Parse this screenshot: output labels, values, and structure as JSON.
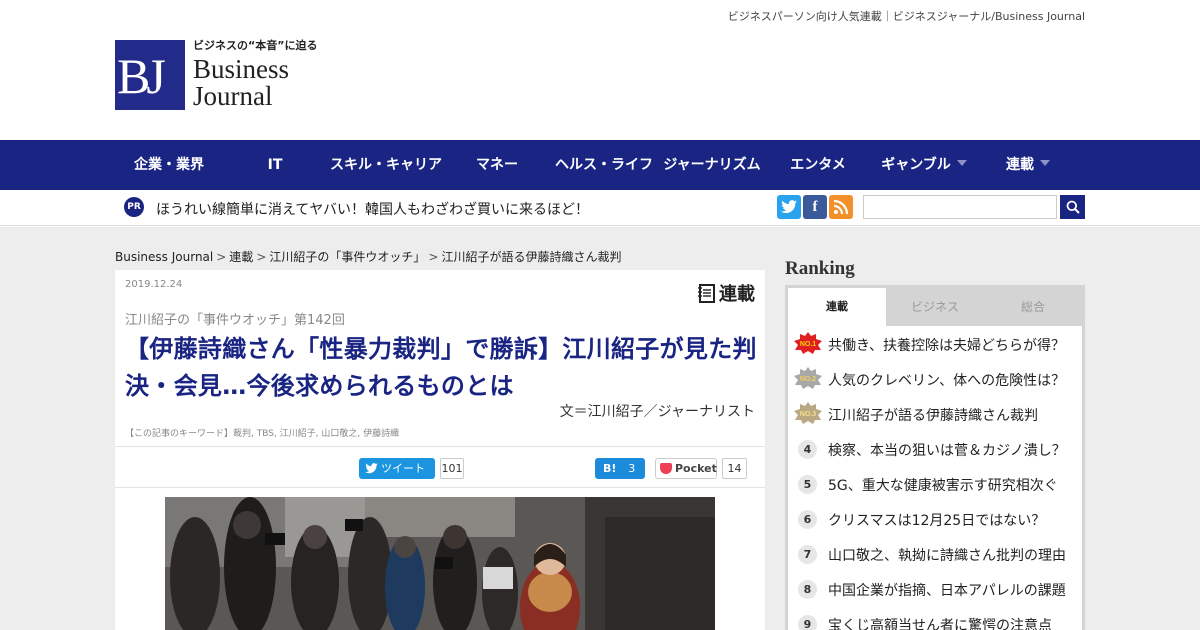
{
  "colors": {
    "brand": "#1a2583",
    "title": "#1a2583",
    "twitter": "#2aa3ef",
    "facebook": "#3a5a99",
    "rss": "#f3902a",
    "hatena": "#1d8bdc",
    "pocket": "#ef3f56"
  },
  "header": {
    "tagline": "ビジネスパーソン向け人気連載｜ビジネスジャーナル/Business Journal",
    "logo_mark": "BJ",
    "logo_sub": "ビジネスの“本音”に迫る",
    "logo_line1": "Business",
    "logo_line2": "Journal"
  },
  "nav": {
    "items": [
      {
        "label": "企業・業界"
      },
      {
        "label": "IT"
      },
      {
        "label": "スキル・キャリア"
      },
      {
        "label": "マネー"
      },
      {
        "label": "ヘルス・ライフ"
      },
      {
        "label": "ジャーナリズム"
      },
      {
        "label": "エンタメ"
      },
      {
        "label": "ギャンブル"
      },
      {
        "label": "連載"
      }
    ]
  },
  "pr": {
    "badge": "PR",
    "text": "ほうれい線簡単に消えてヤバい！韓国人もわざわざ買いに来るほど！"
  },
  "search": {
    "placeholder": ""
  },
  "breadcrumb": [
    "Business Journal",
    "連載",
    "江川紹子の「事件ウオッチ」",
    "江川紹子が語る伊藤詩織さん裁判"
  ],
  "article": {
    "date": "2019.12.24",
    "badge": "連載",
    "series": "江川紹子の「事件ウオッチ」第142回",
    "title": "【伊藤詩織さん「性暴力裁判」で勝訴】江川紹子が見た判決・会見…今後求められるものとは",
    "author": "文＝江川紹子／ジャーナリスト",
    "keywords": "【この記事のキーワード】裁判, TBS, 江川紹子, 山口敬之, 伊藤詩織",
    "share": {
      "tweet_label": "ツイート",
      "tweet_count": "101",
      "hatena_label": "B!",
      "hatena_count": "3",
      "pocket_label": "Pocket",
      "pocket_count": "14"
    }
  },
  "ranking": {
    "title": "Ranking",
    "tabs": [
      "連載",
      "ビジネス",
      "総合"
    ],
    "active_tab": "連載",
    "items": [
      {
        "rank": "1",
        "badge": "NO.1",
        "text": "共働き、扶養控除は夫婦どちらが得？"
      },
      {
        "rank": "2",
        "badge": "NO.2",
        "text": "人気のクレベリン、体への危険性は？"
      },
      {
        "rank": "3",
        "badge": "NO.3",
        "text": "江川紹子が語る伊藤詩織さん裁判"
      },
      {
        "rank": "4",
        "text": "検察、本当の狙いは菅＆カジノ潰し？"
      },
      {
        "rank": "5",
        "text": "5G、重大な健康被害示す研究相次ぐ"
      },
      {
        "rank": "6",
        "text": "クリスマスは12月25日ではない？"
      },
      {
        "rank": "7",
        "text": "山口敬之、執拗に詩織さん批判の理由"
      },
      {
        "rank": "8",
        "text": "中国企業が指摘、日本アパレルの課題"
      },
      {
        "rank": "9",
        "text": "宝くじ高額当せん者に驚愕の注意点"
      }
    ]
  }
}
